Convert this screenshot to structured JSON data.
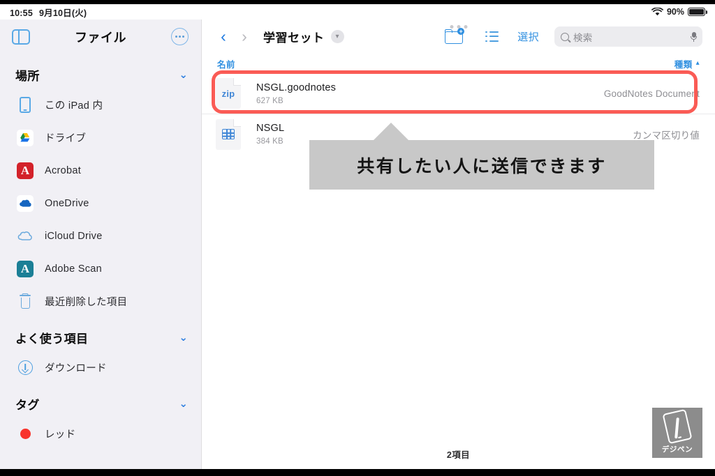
{
  "statusbar": {
    "time": "10:55",
    "date": "9月10日(火)",
    "battery_percent": "90%",
    "wifi_icon": "wifi-icon",
    "battery_icon": "battery-icon"
  },
  "sidebar": {
    "title": "ファイル",
    "toggle_icon": "sidebar-toggle-icon",
    "more_icon": "more-ellipsis-icon",
    "sections": [
      {
        "title": "場所",
        "chevron": "⌄",
        "items": [
          {
            "label": "この iPad 内",
            "icon": "ipad-icon"
          },
          {
            "label": "ドライブ",
            "icon": "google-drive-icon"
          },
          {
            "label": "Acrobat",
            "icon": "adobe-acrobat-icon"
          },
          {
            "label": "OneDrive",
            "icon": "onedrive-icon"
          },
          {
            "label": "iCloud Drive",
            "icon": "icloud-drive-icon"
          },
          {
            "label": "Adobe Scan",
            "icon": "adobe-scan-icon"
          },
          {
            "label": "最近削除した項目",
            "icon": "trash-icon"
          }
        ]
      },
      {
        "title": "よく使う項目",
        "chevron": "⌄",
        "items": [
          {
            "label": "ダウンロード",
            "icon": "download-circle-icon"
          }
        ]
      },
      {
        "title": "タグ",
        "chevron": "⌄",
        "items": [
          {
            "label": "レッド",
            "icon": "red-dot-icon"
          }
        ]
      }
    ]
  },
  "navbar": {
    "back_icon": "chevron-left-icon",
    "forward_icon": "chevron-right-icon",
    "folder_title": "学習セット",
    "folder_menu_icon": "chevron-down-icon",
    "new_folder_icon": "new-folder-icon",
    "list_view_icon": "list-view-icon",
    "select_label": "選択"
  },
  "search": {
    "placeholder": "検索",
    "value": "",
    "search_icon": "search-icon",
    "mic_icon": "microphone-icon"
  },
  "columns": {
    "name": "名前",
    "kind": "種類",
    "sort_caret": "︿"
  },
  "files": [
    {
      "name": "NSGL.goodnotes",
      "size": "627 KB",
      "kind": "GoodNotes Document",
      "icon": "zip-file-icon",
      "icon_text": "zip",
      "highlighted": true
    },
    {
      "name": "NSGL",
      "size": "384 KB",
      "kind": "カンマ区切り値",
      "icon": "csv-file-icon",
      "icon_text": "",
      "highlighted": false
    }
  ],
  "callout": {
    "text": "共有したい人に送信できます"
  },
  "footer": {
    "item_count": "2項目"
  },
  "watermark": {
    "label": "デジペン",
    "icon": "tablet-pen-icon"
  },
  "colors": {
    "accent_blue": "#2f8fe0",
    "highlight_red": "#fa5b55",
    "sidebar_bg": "#f1f0f5",
    "callout_gray": "#c8c8c8"
  }
}
